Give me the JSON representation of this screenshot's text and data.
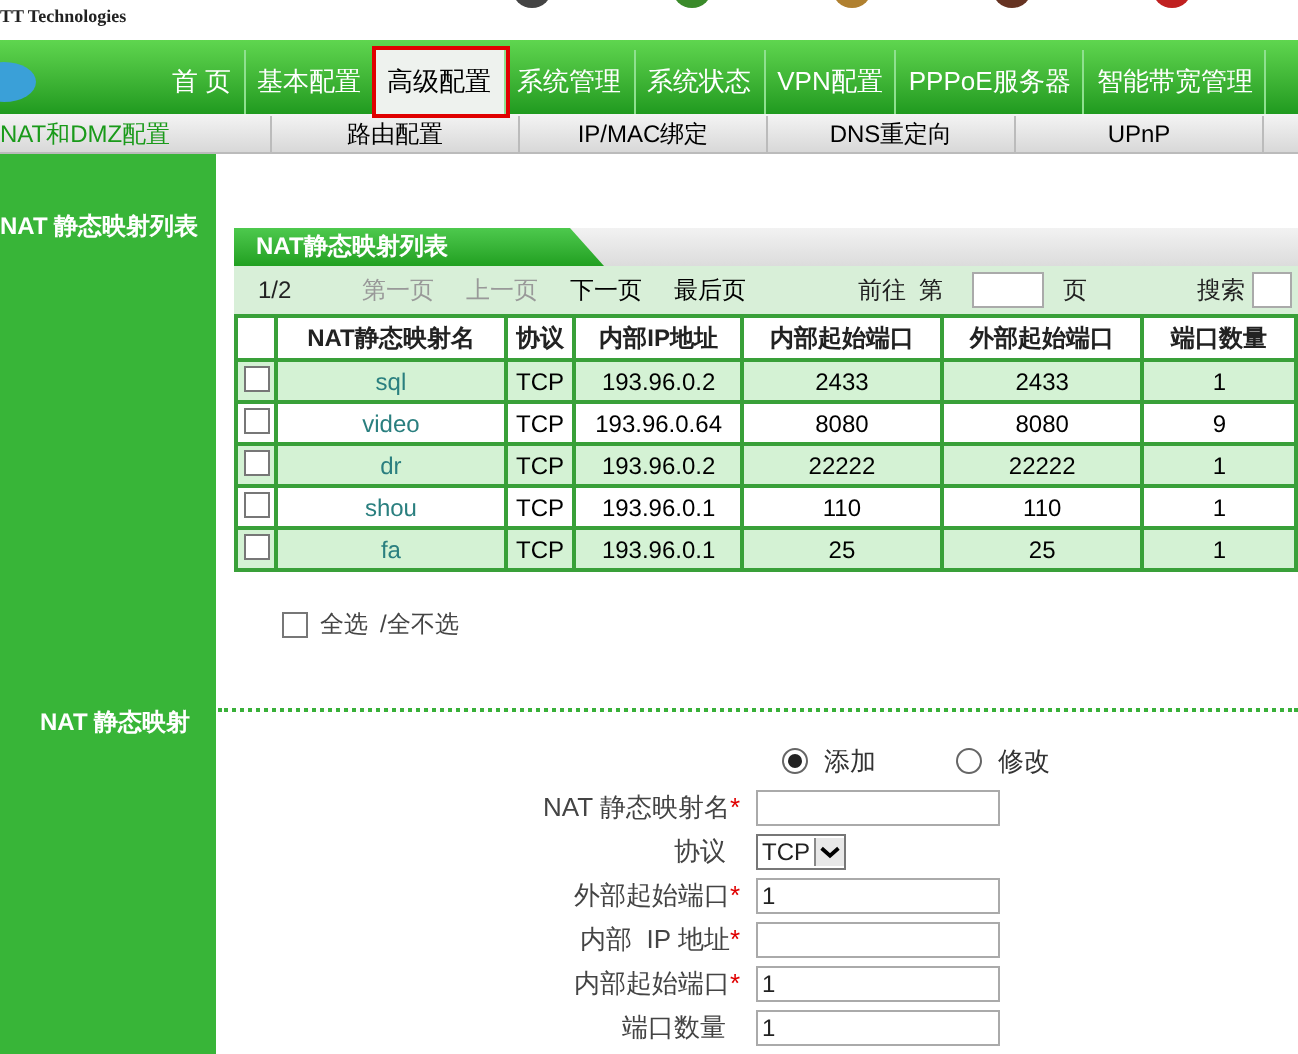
{
  "header": {
    "logo_text": "TT Technologies"
  },
  "nav": {
    "tabs": [
      {
        "label": "首 页",
        "selected": false
      },
      {
        "label": "基本配置",
        "selected": false
      },
      {
        "label": "高级配置",
        "selected": true
      },
      {
        "label": "系统管理",
        "selected": false
      },
      {
        "label": "系统状态",
        "selected": false
      },
      {
        "label": "VPN配置",
        "selected": false
      },
      {
        "label": "PPPoE服务器",
        "selected": false
      },
      {
        "label": "智能带宽管理",
        "selected": false
      }
    ]
  },
  "subnav": {
    "tabs": [
      {
        "label": "NAT和DMZ配置",
        "selected": true
      },
      {
        "label": "路由配置",
        "selected": false
      },
      {
        "label": "IP/MAC绑定",
        "selected": false
      },
      {
        "label": "DNS重定向",
        "selected": false
      },
      {
        "label": "UPnP",
        "selected": false
      }
    ]
  },
  "sidebar": {
    "list_title": "NAT 静态映射列表",
    "form_title": "NAT 静态映射"
  },
  "list": {
    "title": "NAT静态映射列表",
    "pager": {
      "page": "1/2",
      "links": [
        {
          "label": "第一页",
          "disabled": true
        },
        {
          "label": "上一页",
          "disabled": true
        },
        {
          "label": "下一页",
          "disabled": false
        },
        {
          "label": "最后页",
          "disabled": false
        }
      ],
      "goto_label": "前往  第",
      "page_unit": "页",
      "search_label": "搜索"
    },
    "columns": [
      "NAT静态映射名",
      "协议",
      "内部IP地址",
      "内部起始端口",
      "外部起始端口",
      "端口数量"
    ],
    "rows": [
      {
        "checked": false,
        "cells": [
          "sql",
          "TCP",
          "193.96.0.2",
          "2433",
          "2433",
          "1"
        ]
      },
      {
        "checked": false,
        "cells": [
          "video",
          "TCP",
          "193.96.0.64",
          "8080",
          "8080",
          "9"
        ]
      },
      {
        "checked": false,
        "cells": [
          "dr",
          "TCP",
          "193.96.0.2",
          "22222",
          "22222",
          "1"
        ]
      },
      {
        "checked": false,
        "cells": [
          "shou",
          "TCP",
          "193.96.0.1",
          "110",
          "110",
          "1"
        ]
      },
      {
        "checked": false,
        "cells": [
          "fa",
          "TCP",
          "193.96.0.1",
          "25",
          "25",
          "1"
        ]
      }
    ],
    "select_all": {
      "checked": false,
      "label": "全选",
      "sep_label": "/全不选"
    }
  },
  "form": {
    "modes": [
      {
        "label": "添加",
        "selected": true
      },
      {
        "label": "修改",
        "selected": false
      }
    ],
    "fields": [
      {
        "kind": "text",
        "label": "NAT 静态映射名",
        "required_mark": "*"
      },
      {
        "kind": "select",
        "label": "协议",
        "value": "TCP"
      },
      {
        "kind": "text",
        "label": "外部起始端口",
        "required_mark": "*",
        "value": "1"
      },
      {
        "kind": "text",
        "label": "内部  IP 地址",
        "required_mark": "*"
      },
      {
        "kind": "text",
        "label": "内部起始端口",
        "required_mark": "*",
        "value": "1"
      },
      {
        "kind": "text",
        "label": "端口数量",
        "value": "1"
      }
    ]
  }
}
